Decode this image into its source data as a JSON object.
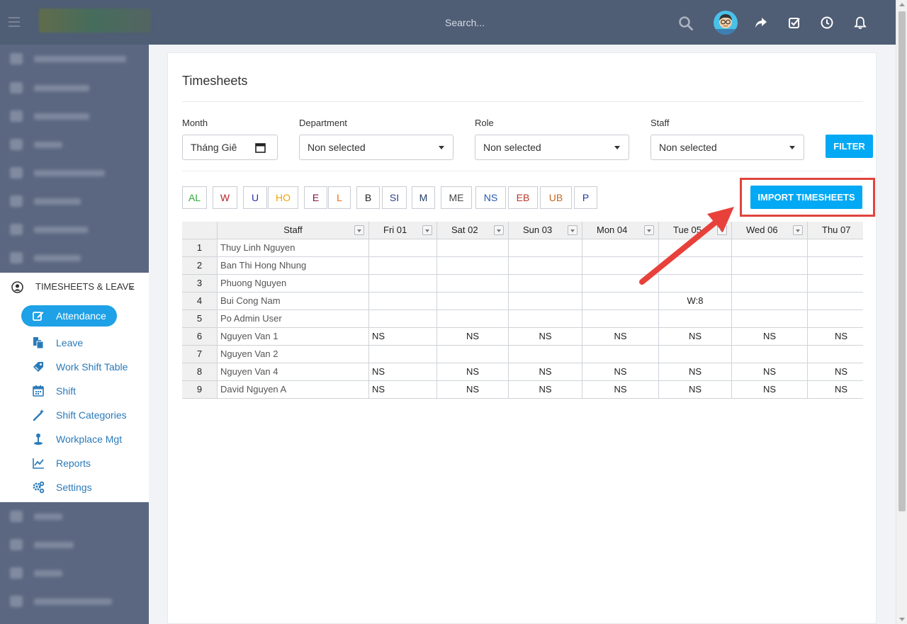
{
  "topbar": {
    "search_placeholder": "Search...",
    "icons": [
      "search-icon",
      "avatar",
      "share-icon",
      "tasks-icon",
      "clock-icon",
      "bell-icon"
    ]
  },
  "sidebar": {
    "active_section": {
      "label": "TIMESHEETS & LEAVE",
      "icon": "user-circle-icon"
    },
    "sub_items": [
      {
        "label": "Attendance",
        "icon": "edit-icon",
        "active": true
      },
      {
        "label": "Leave",
        "icon": "copy-icon"
      },
      {
        "label": "Work Shift Table",
        "icon": "tag-icon"
      },
      {
        "label": "Shift",
        "icon": "calendar-icon"
      },
      {
        "label": "Shift Categories",
        "icon": "magic-wand-icon"
      },
      {
        "label": "Workplace Mgt",
        "icon": "map-pin-icon"
      },
      {
        "label": "Reports",
        "icon": "line-chart-icon"
      },
      {
        "label": "Settings",
        "icon": "cogs-icon"
      }
    ]
  },
  "page": {
    "title": "Timesheets",
    "filters": {
      "month": {
        "label": "Month",
        "value": "Tháng Giê"
      },
      "department": {
        "label": "Department",
        "value": "Non selected"
      },
      "role": {
        "label": "Role",
        "value": "Non selected"
      },
      "staff": {
        "label": "Staff",
        "value": "Non selected"
      },
      "filter_button": "FILTER"
    },
    "legend": [
      {
        "code": "AL",
        "color": "#2eaa3a"
      },
      {
        "code": "W",
        "color": "#b5222a"
      },
      {
        "code": "U",
        "color": "#2433a8"
      },
      {
        "code": "HO",
        "color": "#f0a500"
      },
      {
        "code": "E",
        "color": "#8a1340"
      },
      {
        "code": "L",
        "color": "#f06a1a"
      },
      {
        "code": "B",
        "color": "#222222"
      },
      {
        "code": "SI",
        "color": "#2c3f8c"
      },
      {
        "code": "M",
        "color": "#1d3a5e"
      },
      {
        "code": "ME",
        "color": "#444444"
      },
      {
        "code": "NS",
        "color": "#2458b0"
      },
      {
        "code": "EB",
        "color": "#b8362a"
      },
      {
        "code": "UB",
        "color": "#c8661a"
      },
      {
        "code": "P",
        "color": "#1f3aa8"
      }
    ],
    "import_button": "IMPORT TIMESHEETS",
    "table": {
      "staff_header": "Staff",
      "days": [
        "Fri 01",
        "Sat 02",
        "Sun 03",
        "Mon 04",
        "Tue 05",
        "Wed 06",
        "Thu 07"
      ],
      "rows": [
        {
          "num": "1",
          "staff": "Thuy Linh Nguyen",
          "cells": [
            "",
            "",
            "",
            "",
            "",
            "",
            ""
          ]
        },
        {
          "num": "2",
          "staff": "Ban Thi Hong Nhung",
          "cells": [
            "",
            "",
            "",
            "",
            "",
            "",
            ""
          ]
        },
        {
          "num": "3",
          "staff": "Phuong Nguyen",
          "cells": [
            "",
            "",
            "",
            "",
            "",
            "",
            ""
          ]
        },
        {
          "num": "4",
          "staff": "Bui Cong Nam",
          "cells": [
            "",
            "",
            "",
            "",
            "W:8",
            "",
            ""
          ]
        },
        {
          "num": "5",
          "staff": "Po Admin User",
          "cells": [
            "",
            "",
            "",
            "",
            "",
            "",
            ""
          ]
        },
        {
          "num": "6",
          "staff": "Nguyen Van 1",
          "cells": [
            "NS",
            "NS",
            "NS",
            "NS",
            "NS",
            "NS",
            "NS"
          ]
        },
        {
          "num": "7",
          "staff": "Nguyen Van 2",
          "cells": [
            "",
            "",
            "",
            "",
            "",
            "",
            ""
          ]
        },
        {
          "num": "8",
          "staff": "Nguyen Van 4",
          "cells": [
            "NS",
            "NS",
            "NS",
            "NS",
            "NS",
            "NS",
            "NS"
          ]
        },
        {
          "num": "9",
          "staff": "David Nguyen A",
          "cells": [
            "NS",
            "NS",
            "NS",
            "NS",
            "NS",
            "NS",
            "NS"
          ]
        }
      ]
    }
  },
  "colors": {
    "topbar": "#4f5d75",
    "sidebar": "#5b6781",
    "accent": "#03a9f4",
    "link": "#2a7ab9",
    "highlight": "#e0443e"
  }
}
